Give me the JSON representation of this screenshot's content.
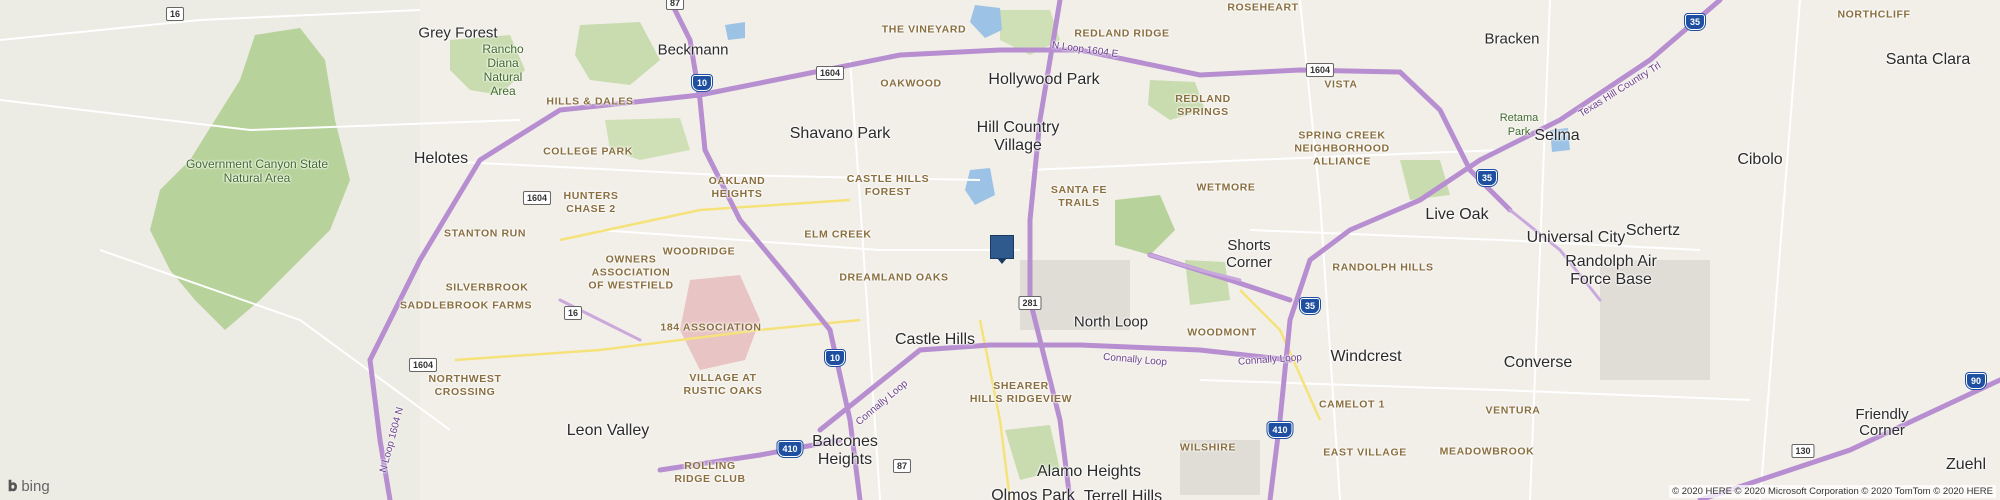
{
  "map": {
    "provider_logo": "bing",
    "copyright": "© 2020 HERE © 2020 Microsoft Corporation © 2020 TomTom © 2020 HERE",
    "colors": {
      "land": "#f2efe9",
      "park": "#a9c98a",
      "park_light": "#c8dcaf",
      "water": "#9cc3e6",
      "highway": "#b78fd1",
      "pin": "#2f5a8e"
    }
  },
  "places": {
    "grey_forest": "Grey Forest",
    "rancho_diana": "Rancho\nDiana\nNatural\nArea",
    "beckmann": "Beckmann",
    "the_vineyard": "THE VINEYARD",
    "redland_ridge": "REDLAND RIDGE",
    "roseheart": "ROSEHEART",
    "bracken": "Bracken",
    "northcliff": "NORTHCLIFF",
    "santa_clara": "Santa Clara",
    "hills_dales": "HILLS & DALES",
    "oakwood": "OAKWOOD",
    "hollywood_park": "Hollywood Park",
    "vista": "VISTA",
    "redland_springs": "REDLAND\nSPRINGS",
    "retama_park": "Retama\nPark",
    "selma": "Selma",
    "government_canyon": "Government Canyon State\nNatural Area",
    "helotes": "Helotes",
    "college_park": "COLLEGE PARK",
    "shavano_park": "Shavano Park",
    "hill_country_village": "Hill Country\nVillage",
    "spring_creek": "SPRING CREEK\nNEIGHBORHOOD\nALLIANCE",
    "cibolo": "Cibolo",
    "oakland_heights": "OAKLAND\nHEIGHTS",
    "castle_hills_forest": "CASTLE HILLS\nFOREST",
    "santa_fe_trails": "SANTA FE\nTRAILS",
    "wetmore": "WETMORE",
    "hunters_chase": "HUNTERS\nCHASE 2",
    "stanton_run": "STANTON RUN",
    "elm_creek": "ELM CREEK",
    "live_oak": "Live Oak",
    "universal_city": "Universal City",
    "schertz": "Schertz",
    "shorts_corner": "Shorts\nCorner",
    "woodridge": "WOODRIDGE",
    "owners_westfield": "OWNERS\nASSOCIATION\nOF WESTFIELD",
    "dreamland_oaks": "DREAMLAND OAKS",
    "randolph_hills": "RANDOLPH HILLS",
    "randolph_afb": "Randolph Air\nForce Base",
    "silverbrook": "SILVERBROOK",
    "saddlebrook_farms": "SADDLEBROOK FARMS",
    "north_loop": "North Loop",
    "association_184": "184 ASSOCIATION",
    "woodmont": "WOODMONT",
    "castle_hills": "Castle Hills",
    "windcrest": "Windcrest",
    "converse": "Converse",
    "northwest_crossing": "NORTHWEST\nCROSSING",
    "village_rustic_oaks": "VILLAGE AT\nRUSTIC OAKS",
    "shearer_hills": "SHEARER\nHILLS RIDGEVIEW",
    "camelot": "CAMELOT 1",
    "ventura": "VENTURA",
    "friendly_corner": "Friendly\nCorner",
    "leon_valley": "Leon Valley",
    "balcones_heights": "Balcones\nHeights",
    "alamo_heights": "Alamo Heights",
    "wilshire": "WILSHIRE",
    "east_village": "EAST VILLAGE",
    "meadowbrook": "MEADOWBROOK",
    "rolling_ridge": "ROLLING\nRIDGE CLUB",
    "zuehl": "Zuehl",
    "olmos_park": "Olmos Park",
    "terrell_hills": "Terrell Hills"
  },
  "roads": {
    "n_loop_1604_e": "N Loop 1604 E",
    "texas_hill_country_trl": "Texas Hill Country Trl",
    "connally_loop_1": "Connally Loop",
    "connally_loop_2": "Connally Loop",
    "connally_loop_3": "Connally Loop",
    "loop_1604_n": "N Loop 1604 N"
  },
  "shields": {
    "s16_top": "16",
    "s87_top": "87",
    "s10_top": "10",
    "s1604_a": "1604",
    "s1604_b": "1604",
    "s1604_c": "1604",
    "s35_top": "35",
    "s1604_d": "1604",
    "s35_mid": "35",
    "s16_mid": "16",
    "s1604_e": "1604",
    "s281": "281",
    "s35_low": "35",
    "s10_low": "10",
    "s410_a": "410",
    "s410_b": "410",
    "s87_low": "87",
    "s90": "90",
    "s130": "130"
  }
}
